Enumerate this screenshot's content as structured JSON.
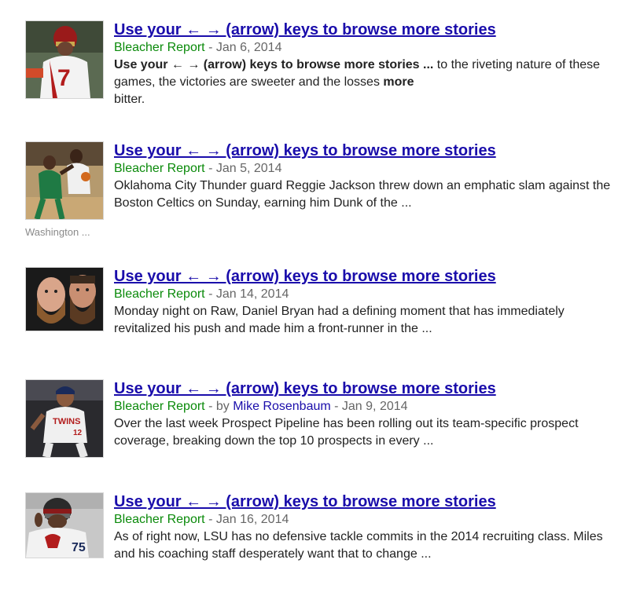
{
  "results": [
    {
      "title": "Use your ← → (arrow) keys to browse more stories",
      "source": "Bleacher Report",
      "sep": " - ",
      "date": "Jan 6, 2014",
      "snippet_bold_1": "Use your ← → (arrow) keys to browse more stories ...",
      "snippet_rest_1": " to the riveting nature of these games, the victories are sweeter and the losses ",
      "snippet_bold_2": "more",
      "snippet_rest_2": " bitter.",
      "thumbnail_icon": "football-player-photo"
    },
    {
      "title": "Use your ← → (arrow) keys to browse more stories",
      "source": "Bleacher Report",
      "sep": " - ",
      "date": "Jan 5, 2014",
      "snippet": "Oklahoma City Thunder guard Reggie Jackson threw down an emphatic slam against the Boston Celtics on Sunday, earning him Dunk of the ...",
      "thumbnail_caption": "Washington ...",
      "thumbnail_icon": "basketball-players-photo"
    },
    {
      "title": "Use your ← → (arrow) keys to browse more stories",
      "source": "Bleacher Report",
      "sep": " - ",
      "date": "Jan 14, 2014",
      "snippet": "Monday night on Raw, Daniel Bryan had a defining moment that has immediately revitalized his push and made him a front-runner in the ...",
      "thumbnail_icon": "bearded-wrestlers-photo"
    },
    {
      "title": "Use your ← → (arrow) keys to browse more stories",
      "source": "Bleacher Report",
      "sep_author": " - by ",
      "author": "Mike Rosenbaum",
      "sep": " - ",
      "date": "Jan 9, 2014",
      "snippet": "Over the last week Prospect Pipeline has been rolling out its team-specific prospect coverage, breaking down the top 10 prospects in every ...",
      "thumbnail_icon": "baseball-player-photo"
    },
    {
      "title": "Use your ← → (arrow) keys to browse more stories",
      "source": "Bleacher Report",
      "sep": " - ",
      "date": "Jan 16, 2014",
      "snippet": "As of right now, LSU has no defensive tackle commits in the 2014 recruiting class. Miles and his coaching staff desperately want that to change ...",
      "thumbnail_icon": "football-lineman-photo"
    }
  ],
  "colors": {
    "title_link": "#1a0dab",
    "source": "#0a8a0a",
    "meta": "#666666",
    "caption": "#8a8a8a"
  }
}
